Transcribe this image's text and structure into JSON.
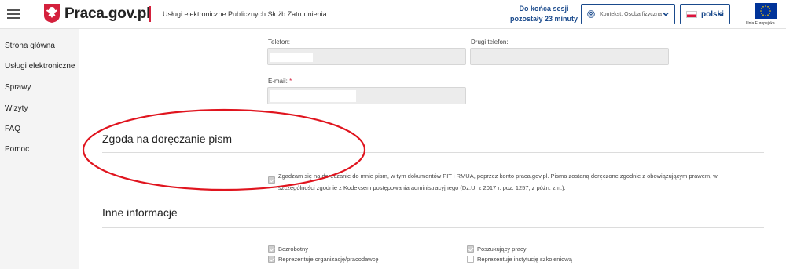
{
  "header": {
    "logo_text": "Praca.gov.pl",
    "service_title": "Usługi elektroniczne Publicznych Służb Zatrudnienia",
    "session_line1": "Do końca sesji",
    "session_line2": "pozostały 23 minuty",
    "context_label": "Kontekst: Osoba fizyczna",
    "language": "polski",
    "eu_label": "Unia Europejska"
  },
  "sidebar": {
    "items": [
      {
        "label": "Strona główna"
      },
      {
        "label": "Usługi elektroniczne"
      },
      {
        "label": "Sprawy"
      },
      {
        "label": "Wizyty"
      },
      {
        "label": "FAQ"
      },
      {
        "label": "Pomoc"
      }
    ]
  },
  "form": {
    "phone_label": "Telefon:",
    "phone2_label": "Drugi telefon:",
    "email_label": "E-mail:",
    "required_mark": "*"
  },
  "consent": {
    "title": "Zgoda na doręczanie pism",
    "checked": true,
    "text": "Zgadzam się na doręczanie do mnie pism, w tym dokumentów PIT i RMUA, poprzez konto praca.gov.pl. Pisma zostaną doręczone zgodnie z obowiązującym prawem, w szczególności zgodnie z Kodeksem postępowania administracyjnego (Dz.U. z 2017 r. poz. 1257, z późn. zm.)."
  },
  "other_info": {
    "title": "Inne informacje",
    "options": [
      {
        "label": "Bezrobotny",
        "checked": true
      },
      {
        "label": "Poszukujący pracy",
        "checked": true
      },
      {
        "label": "Reprezentuje organizację/pracodawcę",
        "checked": true
      },
      {
        "label": "Reprezentuje instytucję szkoleniową",
        "checked": false
      }
    ]
  },
  "colors": {
    "brand_blue": "#1a4a8c",
    "brand_red": "#d4213d",
    "annotation_red": "#e0141e"
  },
  "icons": {
    "menu": "hamburger-icon",
    "user": "user-circle-icon",
    "chevron": "chevron-down-icon",
    "eagle": "polish-eagle-emblem"
  }
}
